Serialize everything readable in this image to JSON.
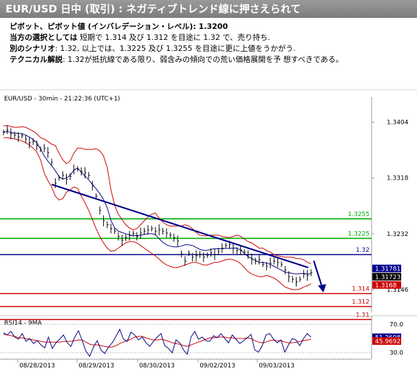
{
  "header": {
    "title": "EUR/USD 日中 (取引) : ネガティブトレンド線に押さえられて"
  },
  "summary": {
    "pivot_label": "ピボット、ピボット値 (インバレデーション・レベル): ",
    "pivot_value": "1.3200",
    "scenario_label": "当方の選択としては",
    "scenario_text": " 短期で 1.314 及び 1.312 を目途に 1.32 で、売り持ち.",
    "alt_label": "別のシナリオ",
    "alt_text": ": 1.32, 以上では、1.3225 及び 1.3255 を目途に更に上値をうかがう.",
    "tech_label": "テクニカル解説",
    "tech_text": ": 1.32が抵抗線である限り、弱含みの傾向での荒い価格展開を予 想すべきである。"
  },
  "chart_data": {
    "type": "line",
    "title": "EUR/USD - 30min - 21:22:36 (UTC+1)",
    "y_ticks": [
      "1.3404",
      "1.3318",
      "1.3232",
      "1.3146"
    ],
    "ylim": [
      1.3111,
      1.3432
    ],
    "x_tick_labels": [
      "08/28/2013",
      "08/29/2013",
      "08/30/2013",
      "09/02/2013",
      "09/03/2013"
    ],
    "price": [
      1.3388,
      1.3392,
      1.3386,
      1.3384,
      1.3381,
      1.3383,
      1.3378,
      1.3372,
      1.3374,
      1.3368,
      1.3362,
      1.3364,
      1.3357,
      1.3342,
      1.331,
      1.3318,
      1.3322,
      1.3316,
      1.332,
      1.3331,
      1.3332,
      1.3328,
      1.3326,
      1.3322,
      1.3306,
      1.329,
      1.3268,
      1.3252,
      1.3246,
      1.324,
      1.3236,
      1.3228,
      1.3222,
      1.3226,
      1.3229,
      1.3232,
      1.3228,
      1.3233,
      1.3236,
      1.3238,
      1.324,
      1.3236,
      1.3238,
      1.3236,
      1.3233,
      1.323,
      1.3226,
      1.3221,
      1.3201,
      1.319,
      1.3202,
      1.3196,
      1.3198,
      1.32,
      1.3196,
      1.3199,
      1.3203,
      1.32,
      1.3205,
      1.321,
      1.3214,
      1.3215,
      1.321,
      1.3206,
      1.3207,
      1.3204,
      1.32,
      1.3193,
      1.319,
      1.3192,
      1.3185,
      1.3182,
      1.3187,
      1.319,
      1.3188,
      1.3185,
      1.3176,
      1.3166,
      1.3162,
      1.3158,
      1.3162,
      1.317,
      1.3168,
      1.3172
    ],
    "upper_band": [
      1.3398,
      1.3399,
      1.3397,
      1.3396,
      1.3396,
      1.3397,
      1.3396,
      1.3393,
      1.339,
      1.3386,
      1.338,
      1.3378,
      1.3374,
      1.337,
      1.3368,
      1.3356,
      1.3346,
      1.334,
      1.3344,
      1.3356,
      1.3364,
      1.3364,
      1.3362,
      1.3362,
      1.3362,
      1.3363,
      1.336,
      1.3352,
      1.3334,
      1.33,
      1.3276,
      1.3262,
      1.3254,
      1.3246,
      1.3241,
      1.3238,
      1.324,
      1.3246,
      1.3252,
      1.3258,
      1.3262,
      1.3264,
      1.3256,
      1.325,
      1.3246,
      1.3244,
      1.3244,
      1.3244,
      1.3244,
      1.3246,
      1.3244,
      1.324,
      1.3234,
      1.323,
      1.3229,
      1.3229,
      1.323,
      1.323,
      1.323,
      1.3228,
      1.3227,
      1.3226,
      1.3228,
      1.323,
      1.3228,
      1.3224,
      1.322,
      1.3218,
      1.3214,
      1.321,
      1.321,
      1.3206,
      1.3204,
      1.32,
      1.3198,
      1.3197,
      1.3196,
      1.3196,
      1.3196,
      1.3194,
      1.3194,
      1.3192,
      1.3188,
      1.3186
    ],
    "lower_band": [
      1.338,
      1.338,
      1.3379,
      1.3378,
      1.3377,
      1.3375,
      1.3372,
      1.3369,
      1.3364,
      1.3358,
      1.3346,
      1.3326,
      1.3314,
      1.3304,
      1.329,
      1.3284,
      1.3286,
      1.3296,
      1.33,
      1.3304,
      1.3302,
      1.329,
      1.328,
      1.3268,
      1.3254,
      1.324,
      1.3228,
      1.3218,
      1.321,
      1.3205,
      1.3206,
      1.321,
      1.3214,
      1.3218,
      1.322,
      1.322,
      1.3218,
      1.3214,
      1.321,
      1.3206,
      1.3202,
      1.3198,
      1.3193,
      1.3188,
      1.3184,
      1.3182,
      1.318,
      1.318,
      1.3182,
      1.3184,
      1.3186,
      1.3188,
      1.3188,
      1.3186,
      1.3184,
      1.3184,
      1.3186,
      1.3188,
      1.3188,
      1.319,
      1.3192,
      1.3193,
      1.3192,
      1.319,
      1.3186,
      1.318,
      1.3174,
      1.317,
      1.3168,
      1.3166,
      1.3166,
      1.3168,
      1.3166,
      1.3164,
      1.316,
      1.3155,
      1.315,
      1.3148,
      1.3146,
      1.3146,
      1.3147,
      1.315,
      1.3152,
      1.3155
    ],
    "levels": [
      {
        "label": "1.3255",
        "value": 1.3255,
        "color": "#00aa00"
      },
      {
        "label": "1.3225",
        "value": 1.3225,
        "color": "#00aa00"
      },
      {
        "label": "1.32",
        "value": 1.32,
        "color": "#00008b"
      },
      {
        "label": "1.314",
        "value": 1.314,
        "color": "#cc0000"
      },
      {
        "label": "1.312",
        "value": 1.312,
        "color": "#cc0000"
      },
      {
        "label": "1.31",
        "value": 1.31,
        "color": "#cc0000"
      }
    ],
    "trendline": {
      "start": 1.3308,
      "end": 1.318,
      "color": "#00008b"
    },
    "price_badges": [
      {
        "label": "1.31781",
        "value": 1.31781,
        "bg": "#00008b"
      },
      {
        "label": "1.31723",
        "value": 1.31723,
        "bg": "#000000"
      },
      {
        "label": "1.3168",
        "value": 1.3168,
        "bg": "#cc0000"
      }
    ],
    "rsi": {
      "title": "RSI14 - 9MA",
      "ylim": [
        22,
        78
      ],
      "ticks": [
        "70.0",
        "30.0"
      ],
      "rsi_values": [
        58,
        55,
        60,
        52,
        49,
        57,
        46,
        50,
        43,
        47,
        41,
        37,
        52,
        36,
        44,
        49,
        55,
        44,
        39,
        52,
        61,
        47,
        32,
        25,
        38,
        47,
        34,
        29,
        38,
        44,
        53,
        63,
        49,
        46,
        59,
        55,
        48,
        52,
        44,
        39,
        46,
        52,
        57,
        40,
        36,
        30,
        48,
        44,
        34,
        28,
        52,
        60,
        49,
        52,
        47,
        46,
        54,
        51,
        57,
        50,
        44,
        55,
        49,
        43,
        47,
        51,
        56,
        34,
        31,
        40,
        55,
        57,
        49,
        44,
        48,
        31,
        41,
        50,
        48,
        40,
        50,
        57,
        52
      ],
      "ma_values": [
        56,
        55,
        54,
        53,
        51,
        51,
        50,
        49,
        48,
        47,
        46,
        45,
        45,
        45,
        45,
        45,
        46,
        46,
        46,
        47,
        48,
        48,
        45,
        42,
        41,
        41,
        40,
        39,
        38,
        38,
        40,
        43,
        45,
        47,
        49,
        52,
        53,
        53,
        51,
        49,
        48,
        48,
        49,
        48,
        46,
        44,
        43,
        42,
        40,
        39,
        41,
        43,
        45,
        47,
        49,
        51,
        51,
        52,
        52,
        52,
        51,
        51,
        50,
        50,
        50,
        51,
        50,
        47,
        45,
        44,
        45,
        47,
        48,
        47,
        47,
        45,
        44,
        44,
        45,
        46,
        47,
        48,
        49
      ],
      "rsi_label": "51.2608",
      "rsi_value": 51.2608,
      "ma_label": "45.9692",
      "ma_value": 45.9692
    },
    "colors": {
      "price": "#000000",
      "bands": "#cc0000",
      "ma": "#00008b",
      "rsi": "#000080",
      "rsi_ma": "#cc0000",
      "arrow": "#00008b"
    }
  }
}
